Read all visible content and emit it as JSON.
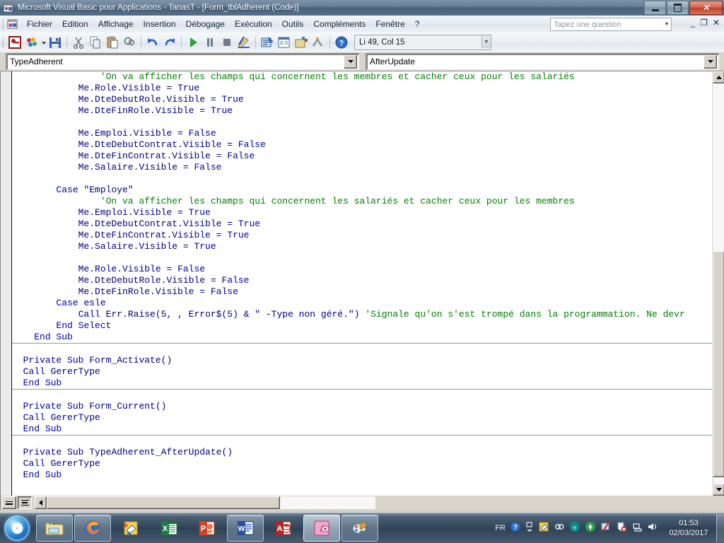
{
  "window": {
    "title": "Microsoft Visual Basic pour Applications - TanasT - [Form_tblAdherent (Code)]",
    "app_icon": "vba-icon",
    "minimize_label": "Réduire",
    "maximize_label": "Restaurer",
    "close_label": "Fermer"
  },
  "menu": {
    "app_icon": "vba-project-icon",
    "items": [
      {
        "label": "Fichier"
      },
      {
        "label": "Edition"
      },
      {
        "label": "Affichage"
      },
      {
        "label": "Insertion"
      },
      {
        "label": "Débogage"
      },
      {
        "label": "Exécution"
      },
      {
        "label": "Outils"
      },
      {
        "label": "Compléments"
      },
      {
        "label": "Fenêtre"
      },
      {
        "label": "?"
      }
    ],
    "ask_placeholder": "Tapez une question",
    "mdi_minimize": "_",
    "mdi_restore": "❐",
    "mdi_close": "✕"
  },
  "toolbar": {
    "buttons": [
      {
        "name": "view-access-icon"
      },
      {
        "name": "insert-object-icon"
      },
      {
        "name": "save-icon"
      },
      {
        "name": "cut-icon"
      },
      {
        "name": "copy-icon"
      },
      {
        "name": "paste-icon"
      },
      {
        "name": "find-icon"
      },
      {
        "name": "undo-icon"
      },
      {
        "name": "redo-icon"
      },
      {
        "name": "run-icon"
      },
      {
        "name": "break-icon"
      },
      {
        "name": "reset-icon"
      },
      {
        "name": "design-mode-icon"
      },
      {
        "name": "project-explorer-icon"
      },
      {
        "name": "properties-window-icon"
      },
      {
        "name": "object-browser-icon"
      },
      {
        "name": "toolbox-icon"
      },
      {
        "name": "help-icon"
      }
    ],
    "position_text": "Li 49, Col 15"
  },
  "code_window": {
    "object_selector": "TypeAdherent",
    "procedure_selector": "AfterUpdate",
    "view_procedure_label": "Affichage Procédure",
    "view_module_label": "Affichage Module complet"
  },
  "code": {
    "lines": [
      {
        "indent": 16,
        "segments": [
          {
            "t": "'On va afficher les champs qui concernent les membres et cacher ceux pour les salariés",
            "c": "cmt"
          }
        ]
      },
      {
        "indent": 12,
        "segments": [
          {
            "t": "Me.Role.Visible = ",
            "c": "id"
          },
          {
            "t": "True",
            "c": "kw"
          }
        ]
      },
      {
        "indent": 12,
        "segments": [
          {
            "t": "Me.DteDebutRole.Visible = ",
            "c": "id"
          },
          {
            "t": "True",
            "c": "kw"
          }
        ]
      },
      {
        "indent": 12,
        "segments": [
          {
            "t": "Me.DteFinRole.Visible = ",
            "c": "id"
          },
          {
            "t": "True",
            "c": "kw"
          }
        ]
      },
      {
        "indent": 0,
        "segments": []
      },
      {
        "indent": 12,
        "segments": [
          {
            "t": "Me.Emploi.Visible = ",
            "c": "id"
          },
          {
            "t": "False",
            "c": "kw"
          }
        ]
      },
      {
        "indent": 12,
        "segments": [
          {
            "t": "Me.DteDebutContrat.Visible = ",
            "c": "id"
          },
          {
            "t": "False",
            "c": "kw"
          }
        ]
      },
      {
        "indent": 12,
        "segments": [
          {
            "t": "Me.DteFinContrat.Visible = ",
            "c": "id"
          },
          {
            "t": "False",
            "c": "kw"
          }
        ]
      },
      {
        "indent": 12,
        "segments": [
          {
            "t": "Me.Salaire.Visible = ",
            "c": "id"
          },
          {
            "t": "False",
            "c": "kw"
          }
        ]
      },
      {
        "indent": 0,
        "segments": []
      },
      {
        "indent": 8,
        "segments": [
          {
            "t": "Case ",
            "c": "kw"
          },
          {
            "t": "\"Employe\"",
            "c": "id"
          }
        ]
      },
      {
        "indent": 16,
        "segments": [
          {
            "t": "'On va afficher les champs qui concernent les salariés et cacher ceux pour les membres",
            "c": "cmt"
          }
        ]
      },
      {
        "indent": 12,
        "segments": [
          {
            "t": "Me.Emploi.Visible = ",
            "c": "id"
          },
          {
            "t": "True",
            "c": "kw"
          }
        ]
      },
      {
        "indent": 12,
        "segments": [
          {
            "t": "Me.DteDebutContrat.Visible = ",
            "c": "id"
          },
          {
            "t": "True",
            "c": "kw"
          }
        ]
      },
      {
        "indent": 12,
        "segments": [
          {
            "t": "Me.DteFinContrat.Visible = ",
            "c": "id"
          },
          {
            "t": "True",
            "c": "kw"
          }
        ]
      },
      {
        "indent": 12,
        "segments": [
          {
            "t": "Me.Salaire.Visible = ",
            "c": "id"
          },
          {
            "t": "True",
            "c": "kw"
          }
        ]
      },
      {
        "indent": 0,
        "segments": []
      },
      {
        "indent": 12,
        "segments": [
          {
            "t": "Me.Role.Visible = ",
            "c": "id"
          },
          {
            "t": "False",
            "c": "kw"
          }
        ]
      },
      {
        "indent": 12,
        "segments": [
          {
            "t": "Me.DteDebutRole.Visible = ",
            "c": "id"
          },
          {
            "t": "False",
            "c": "kw"
          }
        ]
      },
      {
        "indent": 12,
        "segments": [
          {
            "t": "Me.DteFinRole.Visible = ",
            "c": "id"
          },
          {
            "t": "False",
            "c": "kw"
          }
        ]
      },
      {
        "indent": 8,
        "segments": [
          {
            "t": "Case ",
            "c": "kw"
          },
          {
            "t": "esle",
            "c": "id"
          }
        ]
      },
      {
        "indent": 12,
        "segments": [
          {
            "t": "Call ",
            "c": "kw"
          },
          {
            "t": "Err.Raise(5, , Error$(5) & \" -Type non géré.\") ",
            "c": "id"
          },
          {
            "t": "'Signale qu'on s'est trompé dans la programmation. Ne devr",
            "c": "cmt"
          }
        ]
      },
      {
        "indent": 8,
        "segments": [
          {
            "t": "End Select",
            "c": "kw"
          }
        ]
      },
      {
        "indent": 4,
        "segments": [
          {
            "t": "End Sub",
            "c": "kw"
          }
        ]
      },
      {
        "indent": 0,
        "segments": []
      },
      {
        "indent": 2,
        "segments": [
          {
            "t": "Private Sub ",
            "c": "kw"
          },
          {
            "t": "Form_Activate()",
            "c": "id"
          }
        ]
      },
      {
        "indent": 2,
        "segments": [
          {
            "t": "Call ",
            "c": "kw"
          },
          {
            "t": "GererType",
            "c": "id"
          }
        ]
      },
      {
        "indent": 2,
        "segments": [
          {
            "t": "End Sub",
            "c": "kw"
          }
        ]
      },
      {
        "indent": 0,
        "segments": []
      },
      {
        "indent": 2,
        "segments": [
          {
            "t": "Private Sub ",
            "c": "kw"
          },
          {
            "t": "Form_Current()",
            "c": "id"
          }
        ]
      },
      {
        "indent": 2,
        "segments": [
          {
            "t": "Call ",
            "c": "kw"
          },
          {
            "t": "GererType",
            "c": "id"
          }
        ]
      },
      {
        "indent": 2,
        "segments": [
          {
            "t": "End Sub",
            "c": "kw"
          }
        ]
      },
      {
        "indent": 0,
        "segments": []
      },
      {
        "indent": 2,
        "segments": [
          {
            "t": "Private Sub ",
            "c": "kw"
          },
          {
            "t": "TypeAdherent_AfterUpdate()",
            "c": "id"
          }
        ]
      },
      {
        "indent": 2,
        "segments": [
          {
            "t": "Call ",
            "c": "kw"
          },
          {
            "t": "GererType",
            "c": "id"
          }
        ]
      },
      {
        "indent": 2,
        "segments": [
          {
            "t": "End Sub",
            "c": "kw"
          }
        ]
      }
    ],
    "separators_after_line": [
      23,
      27,
      31
    ],
    "colors": {
      "comment": "#008000",
      "keyword": "#0000a0",
      "identifier": "#000080",
      "background": "#ffffff"
    }
  },
  "taskbar": {
    "start_label": "Démarrer",
    "tasks": [
      {
        "name": "taskbar-explorer",
        "label": "Explorateur Windows",
        "pinned": true
      },
      {
        "name": "taskbar-firefox",
        "label": "Mozilla Firefox",
        "pinned": true
      },
      {
        "name": "taskbar-notes",
        "label": "Bloc-notes illustré",
        "pinned": false
      },
      {
        "name": "taskbar-excel",
        "label": "Microsoft Excel",
        "pinned": false
      },
      {
        "name": "taskbar-powerpoint",
        "label": "Microsoft PowerPoint",
        "pinned": false
      },
      {
        "name": "taskbar-word",
        "label": "Microsoft Word",
        "pinned": true
      },
      {
        "name": "taskbar-access",
        "label": "Microsoft Access",
        "pinned": false
      },
      {
        "name": "taskbar-access-vba",
        "label": "Microsoft Access - TanasT",
        "pinned": true
      },
      {
        "name": "taskbar-paint",
        "label": "Paint",
        "pinned": true
      }
    ],
    "tray": {
      "language": "FR",
      "icons": [
        {
          "name": "help-tray-icon"
        },
        {
          "name": "show-hidden-icons-chevron"
        },
        {
          "name": "notes-tray-icon"
        },
        {
          "name": "link-tray-icon"
        },
        {
          "name": "edge-tray-icon"
        },
        {
          "name": "updater-tray-icon"
        },
        {
          "name": "antivirus-tray-icon"
        },
        {
          "name": "action-center-icon"
        },
        {
          "name": "network-icon"
        },
        {
          "name": "volume-icon"
        }
      ]
    },
    "clock": {
      "time": "01:53",
      "date": "02/03/2017"
    }
  }
}
